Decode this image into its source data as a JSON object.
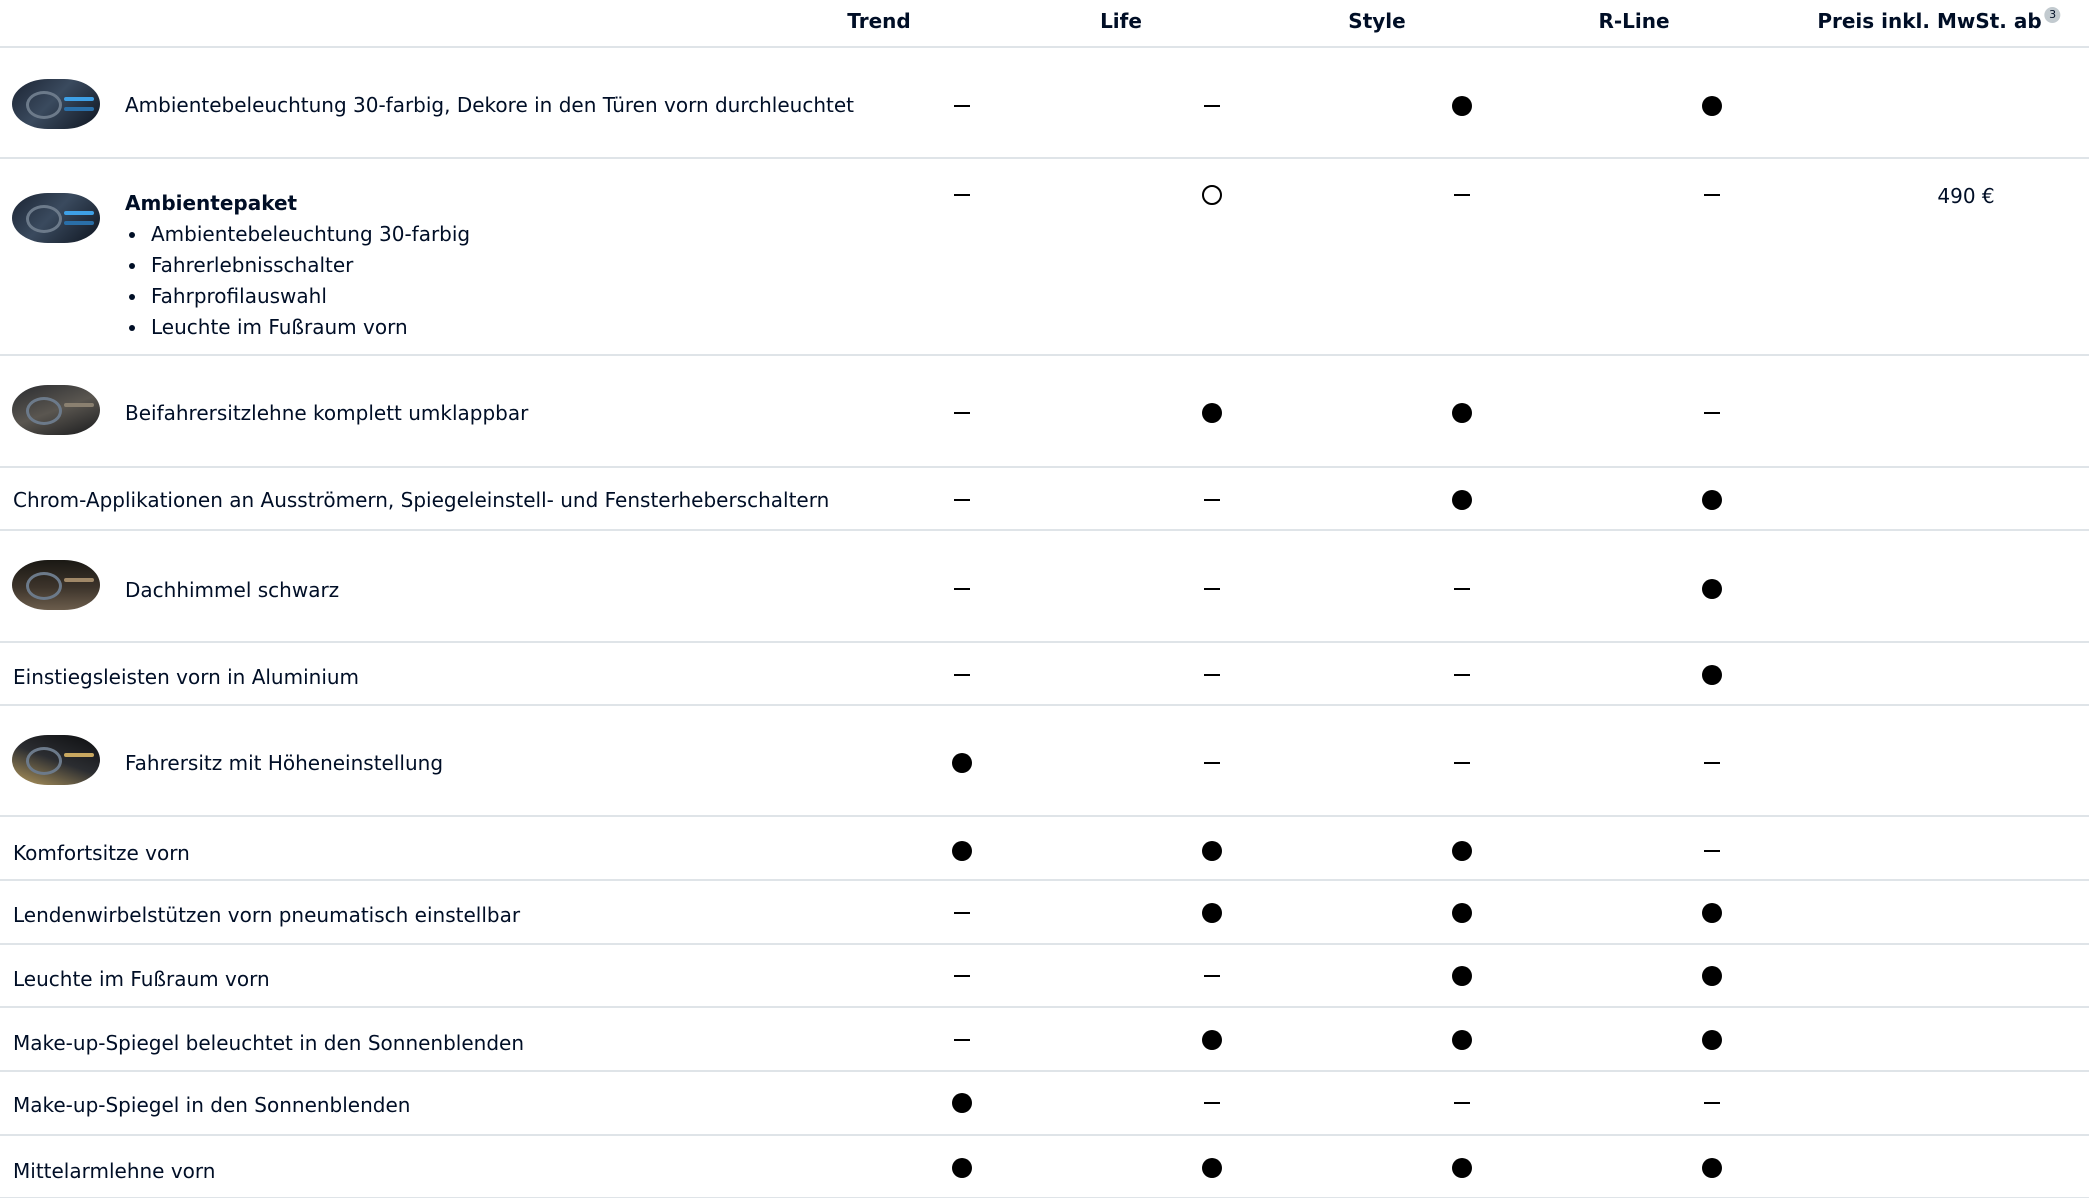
{
  "table": {
    "columns": {
      "trend": "Trend",
      "life": "Life",
      "style": "Style",
      "rline": "R-Line",
      "price": "Preis inkl. MwSt. ab",
      "price_footnote": "3"
    },
    "legend": {
      "dot": "standard",
      "ring": "optional",
      "dash": "not available"
    },
    "rows": [
      {
        "label": "Ambientebeleuchtung 30-farbig, Dekore in den Türen vorn durchleuchtet",
        "thumb": "ambient-lighting-image",
        "values": [
          "dash",
          "dash",
          "dot",
          "dot"
        ],
        "price": ""
      },
      {
        "label": "Ambientepaket",
        "thumb": "ambient-package-image",
        "bullets": [
          "Ambientebeleuchtung 30-farbig",
          "Fahrerlebnisschalter",
          "Fahrprofilauswahl",
          "Leuchte im Fußraum vorn"
        ],
        "values": [
          "dash",
          "ring",
          "dash",
          "dash"
        ],
        "price": "490 €"
      },
      {
        "label": "Beifahrersitzlehne komplett umklappbar",
        "thumb": "passenger-seat-image",
        "values": [
          "dash",
          "dot",
          "dot",
          "dash"
        ],
        "price": ""
      },
      {
        "label": "Chrom-Applikationen an Ausströmern, Spiegeleinstell- und Fensterheberschaltern",
        "values": [
          "dash",
          "dash",
          "dot",
          "dot"
        ],
        "price": ""
      },
      {
        "label": "Dachhimmel schwarz",
        "thumb": "headliner-image",
        "values": [
          "dash",
          "dash",
          "dash",
          "dot"
        ],
        "price": ""
      },
      {
        "label": "Einstiegsleisten vorn in Aluminium",
        "values": [
          "dash",
          "dash",
          "dash",
          "dot"
        ],
        "price": ""
      },
      {
        "label": "Fahrersitz mit Höheneinstellung",
        "thumb": "driver-seat-image",
        "values": [
          "dot",
          "dash",
          "dash",
          "dash"
        ],
        "price": ""
      },
      {
        "label": "Komfortsitze vorn",
        "values": [
          "dot",
          "dot",
          "dot",
          "dash"
        ],
        "price": ""
      },
      {
        "label": "Lendenwirbelstützen vorn pneumatisch einstellbar",
        "values": [
          "dash",
          "dot",
          "dot",
          "dot"
        ],
        "price": ""
      },
      {
        "label": "Leuchte im Fußraum vorn",
        "values": [
          "dash",
          "dash",
          "dot",
          "dot"
        ],
        "price": ""
      },
      {
        "label": "Make-up-Spiegel beleuchtet in den Sonnenblenden",
        "values": [
          "dash",
          "dot",
          "dot",
          "dot"
        ],
        "price": ""
      },
      {
        "label": "Make-up-Spiegel in den Sonnenblenden",
        "values": [
          "dot",
          "dash",
          "dash",
          "dash"
        ],
        "price": ""
      },
      {
        "label": "Mittelarmlehne vorn",
        "values": [
          "dot",
          "dot",
          "dot",
          "dot"
        ],
        "price": ""
      }
    ]
  }
}
